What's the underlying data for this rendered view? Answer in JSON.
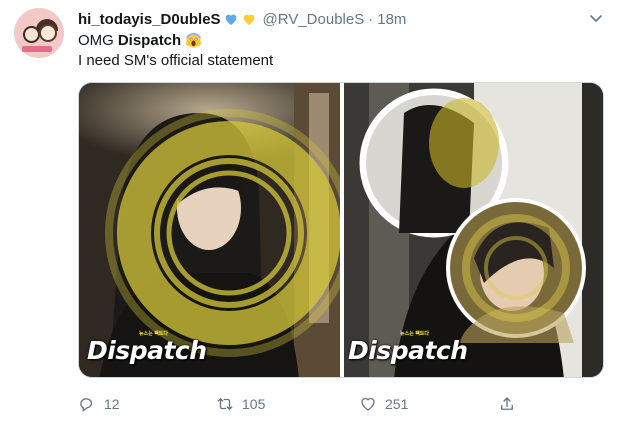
{
  "user": {
    "display_name": "hi_todayis_D0ubleS",
    "handle": "@RV_DoubleS",
    "separator": "·",
    "timestamp": "18m",
    "name_emojis": [
      "blue-heart-icon",
      "yellow-heart-icon"
    ]
  },
  "tweet": {
    "line1_prefix": "OMG",
    "line1_bold": "Dispatch",
    "line1_emoji": "screaming-face-icon",
    "line2": "I need SM's official statement"
  },
  "media": {
    "watermark": "Dispatch",
    "watermark_small": "뉴스는 팩트다"
  },
  "actions": {
    "reply_count": "12",
    "retweet_count": "105",
    "like_count": "251"
  },
  "colors": {
    "text": "#14171a",
    "secondary": "#657786",
    "blue_heart": "#5da9e9",
    "yellow_heart": "#ffcc33"
  }
}
